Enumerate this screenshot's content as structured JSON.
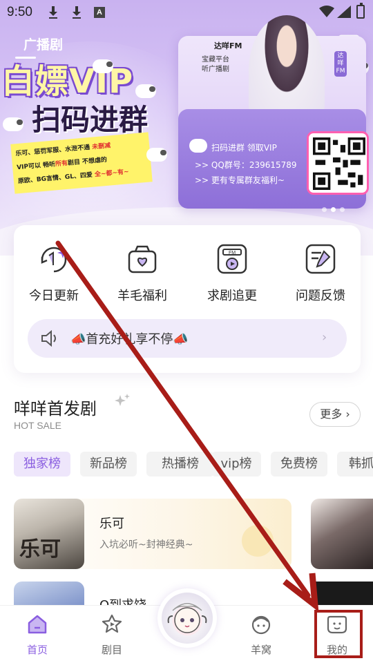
{
  "status_bar": {
    "time": "9:50",
    "icons": [
      "download-icon",
      "download-icon",
      "a-notification-icon",
      "wifi-icon",
      "signal-icon",
      "battery-charging-icon"
    ]
  },
  "hero": {
    "tab_label": "广播剧",
    "banner": {
      "title_line1": "白嫖VIP",
      "title_line2": "扫码进群",
      "promo_lines": [
        {
          "before": "乐可、惩罚军服、水泄不通 ",
          "highlight": "未删减",
          "after": ""
        },
        {
          "before": "VIP可以 畅听",
          "highlight": "所有",
          "after": "剧目 不想虐的"
        },
        {
          "before": "原欧、BG言情、GL、四爱 ",
          "highlight": "全~都~有~",
          "after": ""
        }
      ],
      "card_brand": "达咩FM",
      "card_vertical": "宝藏平台 听广播剧",
      "card_side_brand": "达咩FM",
      "card_row1": "扫码进群 领取VIP",
      "card_row2": ">> QQ群号：239615789",
      "card_row3": ">> 更有专属群友福利~",
      "pager_count": 3,
      "pager_active": 1
    }
  },
  "quick_actions": [
    {
      "label": "今日更新",
      "icon": "refresh-calendar-icon"
    },
    {
      "label": "羊毛福利",
      "icon": "gift-bag-icon"
    },
    {
      "label": "求剧追更",
      "icon": "fm-radio-icon"
    },
    {
      "label": "问题反馈",
      "icon": "feedback-note-icon"
    }
  ],
  "notice": {
    "text": "📣首充好礼享不停📣"
  },
  "section": {
    "title": "咩咩首发剧",
    "subtitle": "HOT SALE",
    "more_label": "更多"
  },
  "rank_tabs": [
    "独家榜",
    "新品榜",
    "热播榜",
    "vip榜",
    "免费榜",
    "韩抓"
  ],
  "rank_active": 0,
  "dramas": [
    {
      "title": "乐可",
      "desc": "入坑必听~封神经典~",
      "cover_text": "乐可"
    },
    {
      "title": "Q到求饶",
      "desc": ""
    }
  ],
  "bottom_nav": [
    {
      "label": "首页",
      "icon": "home-icon",
      "active": true
    },
    {
      "label": "剧目",
      "icon": "star-icon",
      "active": false
    },
    {
      "label": "",
      "icon": "sheep-avatar-icon",
      "active": false
    },
    {
      "label": "羊窝",
      "icon": "sheep-face-icon",
      "active": false
    },
    {
      "label": "我的",
      "icon": "smiley-face-icon",
      "active": false
    }
  ],
  "colors": {
    "accent": "#8a5ee0",
    "annotation": "#a81d18"
  }
}
